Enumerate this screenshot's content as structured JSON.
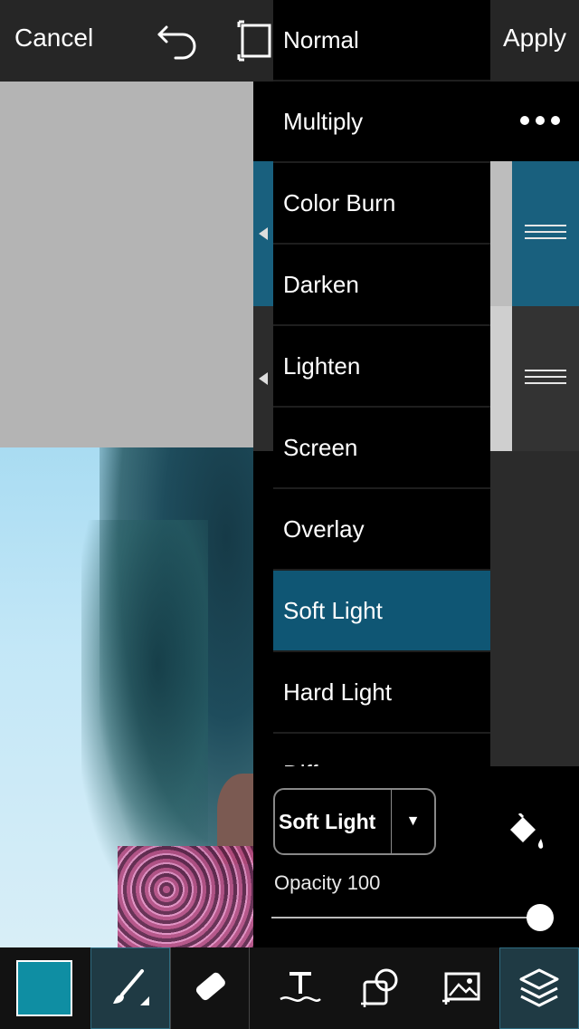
{
  "topbar": {
    "cancel_label": "Cancel",
    "apply_label": "Apply"
  },
  "blend_modes": {
    "items": [
      "Normal",
      "Multiply",
      "Color Burn",
      "Darken",
      "Lighten",
      "Screen",
      "Overlay",
      "Soft Light",
      "Hard Light",
      "Difference"
    ],
    "selected": "Soft Light"
  },
  "settings": {
    "blend_value": "Soft Light",
    "dropdown_arrow": "▼",
    "opacity_label": "Opacity 100",
    "opacity_value": 100
  },
  "toolbar": {
    "color_swatch": "#0f8ea3",
    "items": [
      "color-swatch",
      "brush-icon",
      "eraser-icon",
      "text-icon",
      "add-shape-icon",
      "add-image-icon",
      "layers-icon"
    ]
  },
  "colors": {
    "accent": "#0f5674",
    "layer_selected": "#19607e"
  }
}
